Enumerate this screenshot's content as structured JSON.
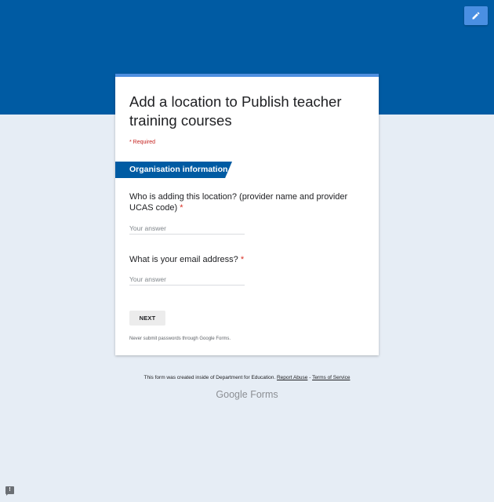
{
  "header": {
    "edit_icon": "pencil-icon",
    "colors": {
      "band": "#005ba3",
      "edit_button": "#4a8fe2",
      "card_accent": "#4e8fe0"
    }
  },
  "form": {
    "title": "Add a location to Publish teacher training courses",
    "required_note": "* Required",
    "section_title": "Organisation information",
    "questions": [
      {
        "label": "Who is adding this location? (provider name and provider UCAS code)",
        "required_mark": "*",
        "placeholder": "Your answer",
        "value": ""
      },
      {
        "label": "What is your email address?",
        "required_mark": "*",
        "placeholder": "Your answer",
        "value": ""
      }
    ],
    "next_label": "NEXT",
    "password_note": "Never submit passwords through Google Forms."
  },
  "footer": {
    "created_text": "This form was created inside of Department for Education.",
    "report_abuse": "Report Abuse",
    "separator": "-",
    "terms": "Terms of Service",
    "logo_google": "Google",
    "logo_forms": "Forms"
  },
  "report_issue": {
    "icon": "report-issue-icon",
    "glyph": "!"
  }
}
